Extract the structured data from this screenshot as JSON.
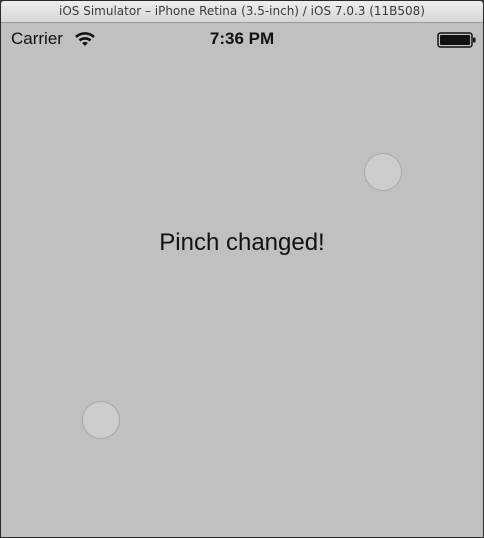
{
  "window": {
    "title": "iOS Simulator – iPhone Retina (3.5-inch) / iOS 7.0.3 (11B508)"
  },
  "status_bar": {
    "carrier": "Carrier",
    "time": "7:36 PM",
    "icons": [
      "wifi-icon",
      "battery-icon"
    ]
  },
  "screen": {
    "message": "Pinch changed!",
    "touch_points": [
      "touch-point",
      "touch-point"
    ]
  },
  "colors": {
    "screen_background": "#c0c0c0",
    "touch_fill": "#cdcdcd"
  }
}
